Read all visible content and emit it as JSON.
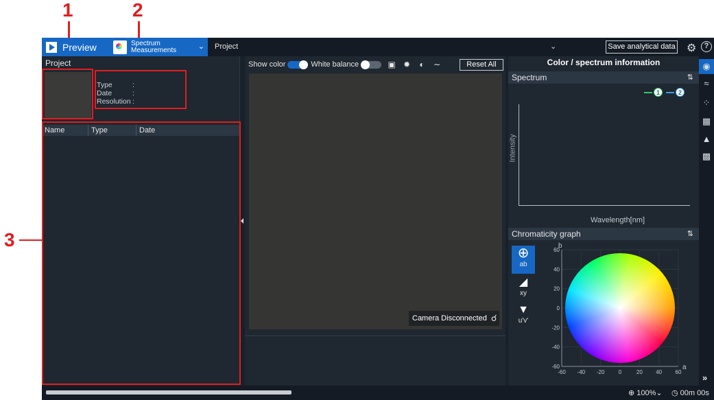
{
  "annotations": {
    "n1": "1",
    "n2": "2",
    "n3": "3"
  },
  "toolbar": {
    "preview_label": "Preview",
    "spectrum_line1": "Spectrum",
    "spectrum_line2": "Measurements",
    "project_label": "Project",
    "save_label": "Save analytical data"
  },
  "project_panel": {
    "title": "Project",
    "meta": [
      {
        "key": "Type",
        "sep": ":"
      },
      {
        "key": "Date",
        "sep": ":"
      },
      {
        "key": "Resolution",
        "sep": ":"
      }
    ],
    "columns": [
      "Name",
      "Type",
      "Date"
    ]
  },
  "preview_panel": {
    "show_color_label": "Show color",
    "white_balance_label": "White balance",
    "show_color_on": true,
    "white_balance_on": false,
    "reset_label": "Reset All",
    "camera_status": "Camera Disconnected"
  },
  "info_panel": {
    "title": "Color / spectrum information",
    "spectrum_heading": "Spectrum",
    "legend": [
      {
        "label": "1",
        "color": "#2ecc71"
      },
      {
        "label": "2",
        "color": "#3aa0e8"
      }
    ],
    "y_axis_label": "Intensity",
    "x_axis_label": "Wavelength[nm]",
    "chroma_heading": "Chromaticity graph",
    "chroma_modes": [
      "ab",
      "xy",
      "u'v'"
    ],
    "chroma_active": "ab"
  },
  "chart_data": {
    "type": "scatter",
    "xlabel": "a",
    "ylabel": "b",
    "xlim": [
      -60,
      60
    ],
    "ylim": [
      -60,
      60
    ],
    "x_ticks": [
      "-60",
      "-40",
      "-20",
      "0",
      "20",
      "40",
      "60"
    ],
    "y_ticks": [
      "60",
      "40",
      "20",
      "0",
      "-20",
      "-40",
      "-60"
    ],
    "grid": true,
    "series": []
  },
  "status": {
    "zoom": "100%",
    "timer": "00m 00s"
  }
}
